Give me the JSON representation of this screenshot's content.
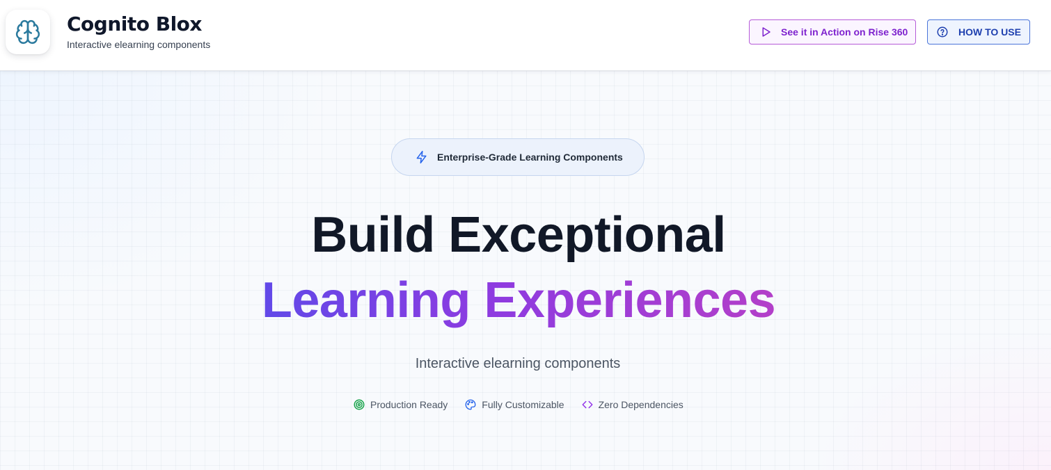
{
  "header": {
    "brand_title": "Cognito Blox",
    "brand_subtitle": "Interactive elearning components",
    "logo_icon": "brain-icon",
    "rise_button": {
      "label": "See it in Action on Rise 360",
      "icon": "play-icon"
    },
    "how_button": {
      "label": "HOW TO USE",
      "icon": "help-circle-icon"
    }
  },
  "hero": {
    "badge": {
      "label": "Enterprise-Grade Learning Components",
      "icon": "lightning-icon"
    },
    "headline_line1": "Build Exceptional",
    "headline_line2": "Learning Experiences",
    "subtitle": "Interactive elearning components",
    "features": [
      {
        "label": "Production Ready",
        "icon": "target-icon",
        "color": "#16a34a"
      },
      {
        "label": "Fully Customizable",
        "icon": "palette-icon",
        "color": "#2563eb"
      },
      {
        "label": "Zero Dependencies",
        "icon": "code-icon",
        "color": "#9333ea"
      }
    ]
  },
  "colors": {
    "headline": "#111827",
    "gradient_start": "#6149e8",
    "gradient_mid": "#8e3be0",
    "gradient_end": "#b33fc9",
    "rise_accent": "#7e22ce",
    "how_accent": "#1e40af"
  }
}
